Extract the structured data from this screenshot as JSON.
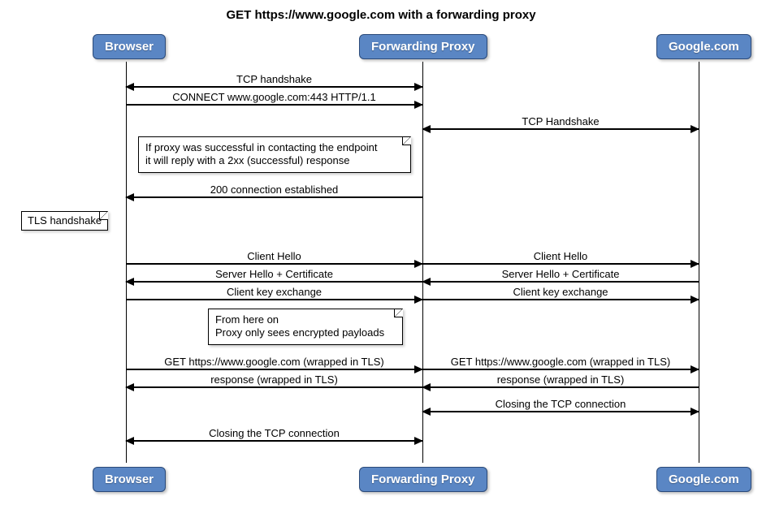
{
  "title": "GET https://www.google.com with a forwarding proxy",
  "actors": {
    "browser": "Browser",
    "proxy": "Forwarding Proxy",
    "google": "Google.com"
  },
  "messages": {
    "m1": "TCP handshake",
    "m2": "CONNECT www.google.com:443 HTTP/1.1",
    "m3": "TCP Handshake",
    "m4": "200 connection established",
    "m5": "Client Hello",
    "m6": "Client Hello",
    "m7": "Server Hello + Certificate",
    "m8": "Server Hello + Certificate",
    "m9": "Client key exchange",
    "m10": "Client key exchange",
    "m11": "GET https://www.google.com (wrapped in TLS)",
    "m12": "GET https://www.google.com (wrapped in TLS)",
    "m13": "response (wrapped in TLS)",
    "m14": "response (wrapped in TLS)",
    "m15": "Closing the TCP connection",
    "m16": "Closing the TCP connection"
  },
  "notes": {
    "n1_l1": "If proxy was successful in contacting the endpoint",
    "n1_l2": "it will reply with a 2xx (successful) response",
    "n2": "TLS handshake",
    "n3_l1": "From here on",
    "n3_l2": "Proxy only sees encrypted payloads"
  }
}
